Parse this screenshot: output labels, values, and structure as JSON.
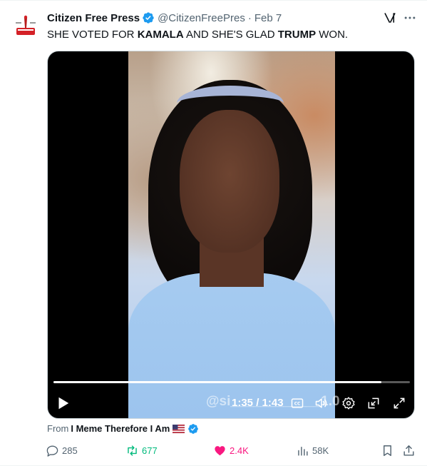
{
  "tweet": {
    "display_name": "Citizen Free Press",
    "handle": "@CitizenFreePres",
    "separator": "·",
    "date": "Feb 7",
    "text_parts": [
      "SHE VOTED FOR ",
      "KAMALA",
      " AND SHE'S GLAD ",
      "TRUMP",
      " WON."
    ]
  },
  "video": {
    "watermark": "@si____________1.0",
    "time": "1:35 / 1:43",
    "progress": 0.92
  },
  "source": {
    "prefix": "From",
    "author": "I Meme Therefore I Am"
  },
  "actions": {
    "replies": "285",
    "reposts": "677",
    "likes": "2.4K",
    "views": "58K"
  },
  "colors": {
    "verified_blue": "#1d9bf0",
    "repost_green": "#00ba7c",
    "like_pink": "#f91880",
    "secondary_text": "#536471"
  },
  "icons": [
    "verified-badge-icon",
    "grok-icon",
    "more-icon",
    "play-icon",
    "captions-icon",
    "volume-icon",
    "settings-icon",
    "pip-icon",
    "fullscreen-icon",
    "reply-icon",
    "repost-icon",
    "like-icon",
    "views-icon",
    "bookmark-icon",
    "share-icon"
  ]
}
